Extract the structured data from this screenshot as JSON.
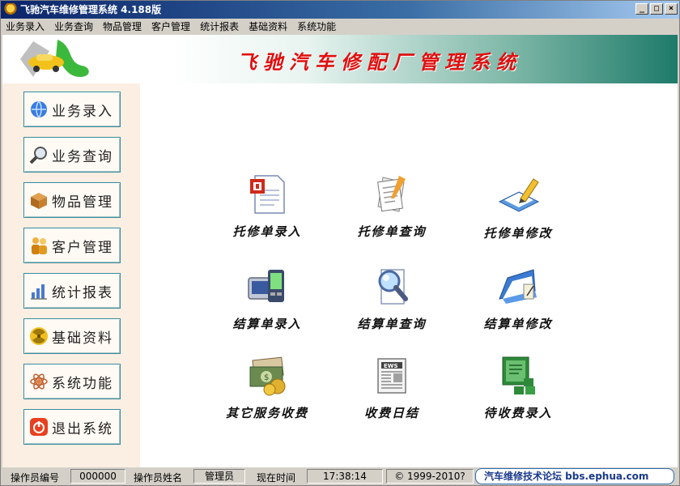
{
  "window": {
    "title": "飞驰汽车维修管理系统 4.188版"
  },
  "menu": [
    "业务录入",
    "业务查询",
    "物品管理",
    "客户管理",
    "统计报表",
    "基础资料",
    "系统功能"
  ],
  "banner": {
    "title": "飞驰汽车修配厂管理系统"
  },
  "sidebar": [
    {
      "label": "业务录入",
      "icon": "globe-icon"
    },
    {
      "label": "业务查询",
      "icon": "magnifier-icon"
    },
    {
      "label": "物品管理",
      "icon": "box-icon"
    },
    {
      "label": "客户管理",
      "icon": "people-icon"
    },
    {
      "label": "统计报表",
      "icon": "bar-chart-icon"
    },
    {
      "label": "基础资料",
      "icon": "radiation-icon"
    },
    {
      "label": "系统功能",
      "icon": "atom-icon"
    },
    {
      "label": "退出系统",
      "icon": "power-icon"
    }
  ],
  "tiles": [
    {
      "label": "托修单录入",
      "icon": "document-entry-icon"
    },
    {
      "label": "托修单查询",
      "icon": "documents-icon"
    },
    {
      "label": "托修单修改",
      "icon": "edit-document-icon"
    },
    {
      "label": "结算单录入",
      "icon": "pda-icon"
    },
    {
      "label": "结算单查询",
      "icon": "search-document-icon"
    },
    {
      "label": "结算单修改",
      "icon": "folder-edit-icon"
    },
    {
      "label": "其它服务收费",
      "icon": "money-icon"
    },
    {
      "label": "收费日结",
      "icon": "newspaper-icon"
    },
    {
      "label": "待收费录入",
      "icon": "green-document-icon"
    }
  ],
  "status": {
    "operator_id_label": "操作员编号",
    "operator_id": "000000",
    "operator_name_label": "操作员姓名",
    "operator_name": "管理员",
    "time_label": "现在时间",
    "time": "17:38:14",
    "copyright": "© 1999-2010?",
    "forum": "汽车维修技术论坛 bbs.ephua.com"
  }
}
